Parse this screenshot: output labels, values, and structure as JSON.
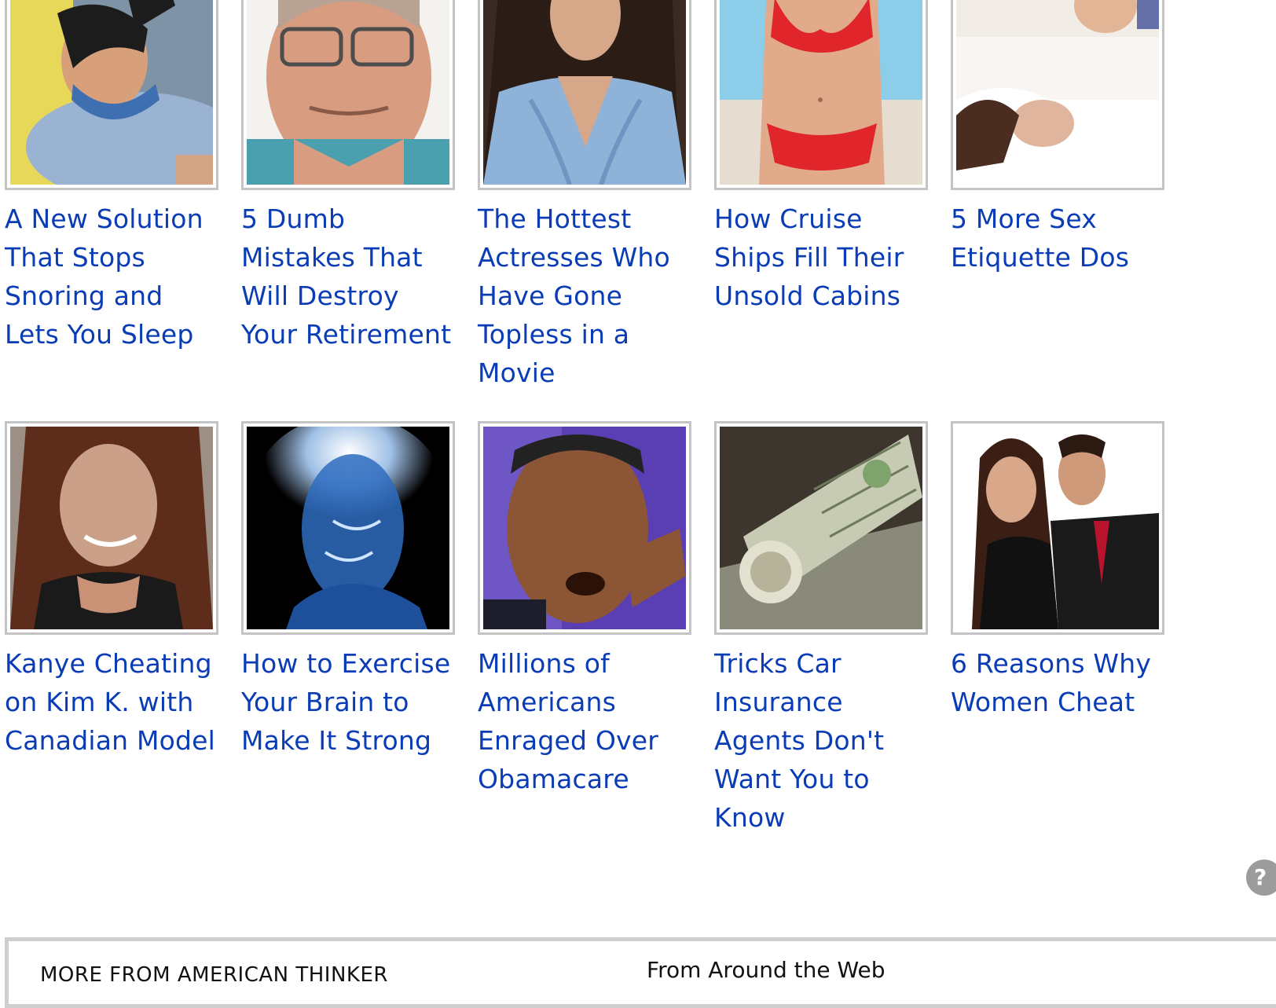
{
  "ads": [
    {
      "title": "A New Solution That Stops Snoring and Lets You Sleep",
      "image": "man-sleeping-chin-strap-photo"
    },
    {
      "title": "5 Dumb Mistakes That Will Destroy Your Retirement",
      "image": "worried-old-man-photo"
    },
    {
      "title": "The Hottest Actresses Who Have Gone Topless in a Movie",
      "image": "actress-blue-dress-photo"
    },
    {
      "title": "How Cruise Ships Fill Their Unsold Cabins",
      "image": "woman-red-bikini-photo"
    },
    {
      "title": "5 More Sex Etiquette Dos",
      "image": "couple-in-bed-photo"
    },
    {
      "title": "Kanye Cheating on Kim K. with Canadian Model",
      "image": "smiling-woman-photo"
    },
    {
      "title": "How to Exercise Your Brain to Make It Strong",
      "image": "glowing-brain-xray-photo"
    },
    {
      "title": "Millions of Americans Enraged Over Obamacare",
      "image": "obama-speaking-photo"
    },
    {
      "title": "Tricks Car Insurance Agents Don't Want You to Know",
      "image": "rolled-dollar-bills-photo"
    },
    {
      "title": "6 Reasons Why Women Cheat",
      "image": "couple-embracing-photo"
    }
  ],
  "help_badge": "?",
  "footer": {
    "left_heading": "MORE FROM AMERICAN THINKER",
    "right_heading": "From Around the Web"
  },
  "colors": {
    "link": "#0a3cb6",
    "frame": "#c4c4c4"
  }
}
